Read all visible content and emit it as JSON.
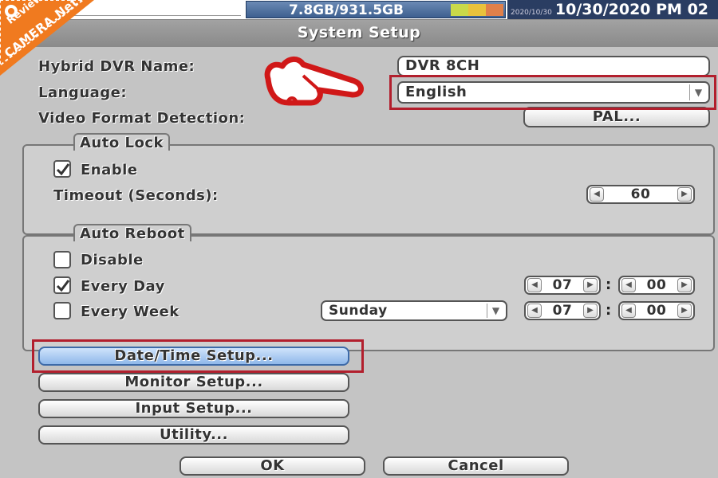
{
  "watermark": {
    "line1": "Review",
    "line2": "CAMERA.Net"
  },
  "status": {
    "disk_usage": "7.8GB/931.5GB",
    "clock_small": "2020/10/30",
    "clock": "10/30/2020 PM 02"
  },
  "window": {
    "title": "System Setup"
  },
  "form": {
    "dvr_name_label": "Hybrid DVR Name:",
    "dvr_name_value": "DVR 8CH",
    "language_label": "Language:",
    "language_value": "English",
    "video_format_label": "Video Format Detection:",
    "video_format_button": "PAL..."
  },
  "auto_lock": {
    "title": "Auto Lock",
    "enable_label": "Enable",
    "enable_checked": true,
    "timeout_label": "Timeout (Seconds):",
    "timeout_value": "60"
  },
  "auto_reboot": {
    "title": "Auto Reboot",
    "disable_label": "Disable",
    "disable_checked": false,
    "every_day_label": "Every Day",
    "every_day_checked": true,
    "every_day_hour": "07",
    "every_day_minute": "00",
    "every_week_label": "Every Week",
    "every_week_checked": false,
    "every_week_day": "Sunday",
    "every_week_hour": "07",
    "every_week_minute": "00",
    "time_separator": ":"
  },
  "buttons": {
    "date_time": "Date/Time Setup...",
    "monitor": "Monitor Setup...",
    "input": "Input Setup...",
    "utility": "Utility...",
    "ok": "OK",
    "cancel": "Cancel"
  },
  "colors": {
    "highlight": "#b21f2d",
    "accent_blue": "#3d5f8f"
  }
}
